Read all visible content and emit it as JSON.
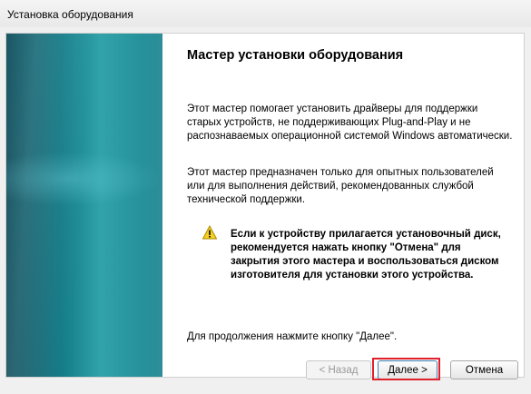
{
  "window": {
    "title": "Установка оборудования"
  },
  "wizard": {
    "heading": "Мастер установки оборудования",
    "paragraph1": "Этот мастер помогает установить драйверы для поддержки старых устройств, не поддерживающих Plug-and-Play и не распознаваемых операционной системой Windows автоматически.",
    "paragraph2": "Этот мастер предназначен только для опытных пользователей или для выполнения действий, рекомендованных службой технической поддержки.",
    "warning": "Если к устройству прилагается установочный диск, рекомендуется нажать кнопку \"Отмена\" для закрытия этого мастера и воспользоваться диском изготовителя для установки этого устройства.",
    "continue_hint": "Для продолжения нажмите кнопку \"Далее\".",
    "warning_icon": "warning-triangle-icon"
  },
  "buttons": {
    "back": "< Назад",
    "next": "Далее >",
    "cancel": "Отмена"
  },
  "colors": {
    "highlight": "#e0202a",
    "banner": "#127a86"
  }
}
